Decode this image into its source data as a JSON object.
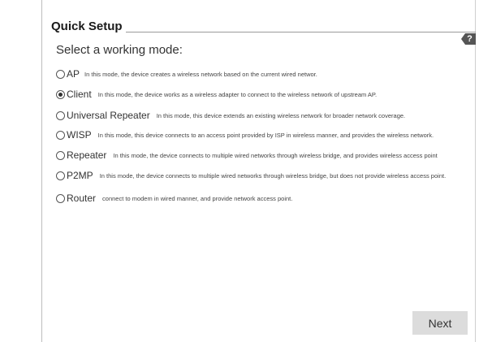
{
  "header": {
    "title": "Quick Setup",
    "help_label": "?"
  },
  "subtitle": "Select a working mode:",
  "modes": [
    {
      "name": "AP",
      "checked": false,
      "description": "In this mode, the device creates a wireless network based on the current wired networ."
    },
    {
      "name": "Client",
      "checked": true,
      "description": "In this mode, the device works as a wireless adapter to connect to the wireless network of upstream AP."
    },
    {
      "name": "Universal Repeater",
      "checked": false,
      "description": "In this mode, this device extends an existing wireless network for broader network coverage."
    },
    {
      "name": "WISP",
      "checked": false,
      "description": "In this mode, this device connects to an access point provided by ISP in wireless manner, and provides the wireless network."
    },
    {
      "name": "Repeater",
      "checked": false,
      "description": "In this mode, the device connects to multiple wired networks through wireless bridge, and provides wireless access point"
    },
    {
      "name": "P2MP",
      "checked": false,
      "description": "In this mode, the device connects to multiple wired networks through wireless bridge, but does not provide wireless access point."
    },
    {
      "name": "Router",
      "checked": false,
      "description": "connect to modem in wired manner, and provide network access point."
    }
  ],
  "actions": {
    "next_label": "Next"
  }
}
